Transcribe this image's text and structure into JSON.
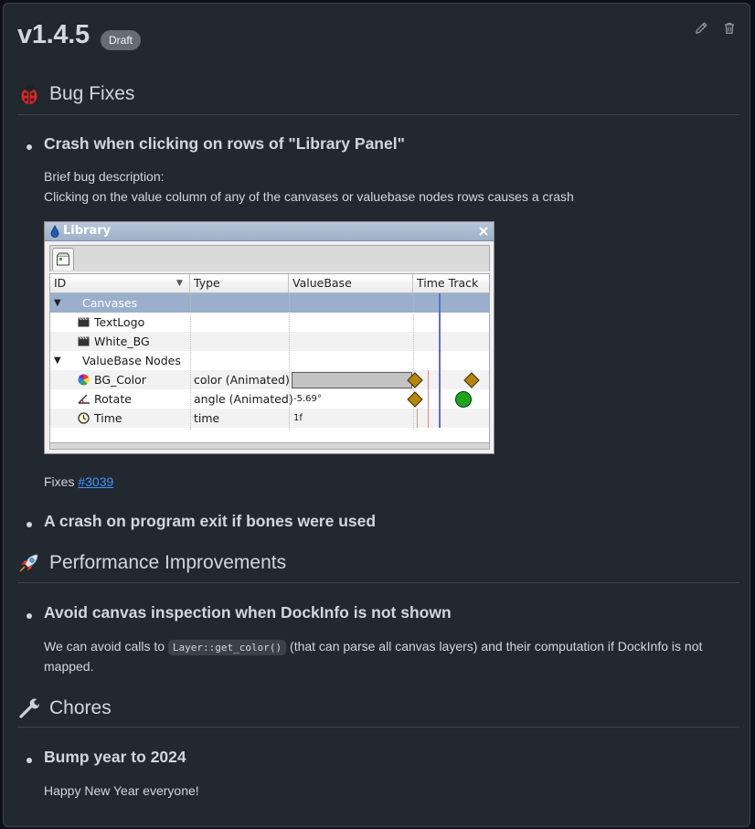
{
  "release": {
    "title": "v1.4.5",
    "badge": "Draft",
    "edit_icon": "pencil-icon",
    "delete_icon": "trash-icon"
  },
  "sections": {
    "bug_fixes": {
      "emoji": "ladybug-icon",
      "heading": "Bug Fixes",
      "item1": {
        "title": "Crash when clicking on rows of \"Library Panel\"",
        "desc_line1": "Brief bug description:",
        "desc_line2": "Clicking on the value column of any of the canvases or valuebase nodes rows causes a crash",
        "fixes_prefix": "Fixes ",
        "fixes_link": "#3039"
      },
      "item2": {
        "title": "A crash on program exit if bones were used"
      }
    },
    "performance": {
      "emoji": "rocket-icon",
      "heading": "Performance Improvements",
      "item1": {
        "title": "Avoid canvas inspection when DockInfo is not shown",
        "text_before": "We can avoid calls to ",
        "code": "Layer::get_color()",
        "text_after": " (that can parse all canvas layers) and their computation if DockInfo is not mapped."
      }
    },
    "chores": {
      "emoji": "wrench-icon",
      "heading": "Chores",
      "item1": {
        "title": "Bump year to 2024",
        "text": "Happy New Year everyone!"
      }
    }
  },
  "library_screenshot": {
    "window_title": "Library",
    "columns": [
      "ID",
      "Type",
      "ValueBase",
      "Time Track"
    ],
    "rows": [
      {
        "id": "Canvases",
        "type": "",
        "value": "",
        "expander": "▼",
        "icon": ""
      },
      {
        "id": "TextLogo",
        "type": "",
        "value": "",
        "expander": "",
        "icon": "clapper-icon"
      },
      {
        "id": "White_BG",
        "type": "",
        "value": "",
        "expander": "",
        "icon": "clapper-icon"
      },
      {
        "id": "ValueBase Nodes",
        "type": "",
        "value": "",
        "expander": "▼",
        "icon": ""
      },
      {
        "id": "BG_Color",
        "type": "color (Animated)",
        "value": "",
        "expander": "",
        "icon": "color-wheel-icon"
      },
      {
        "id": "Rotate",
        "type": "angle (Animated)",
        "value": "-5.69°",
        "expander": "",
        "icon": "angle-icon"
      },
      {
        "id": "Time",
        "type": "time",
        "value": "1f",
        "expander": "",
        "icon": "clock-icon"
      }
    ],
    "colors": {
      "waypoint_diamond": "#b8860b",
      "waypoint_circle": "#1fa31f",
      "time_cursor": "#5a6de0"
    }
  }
}
